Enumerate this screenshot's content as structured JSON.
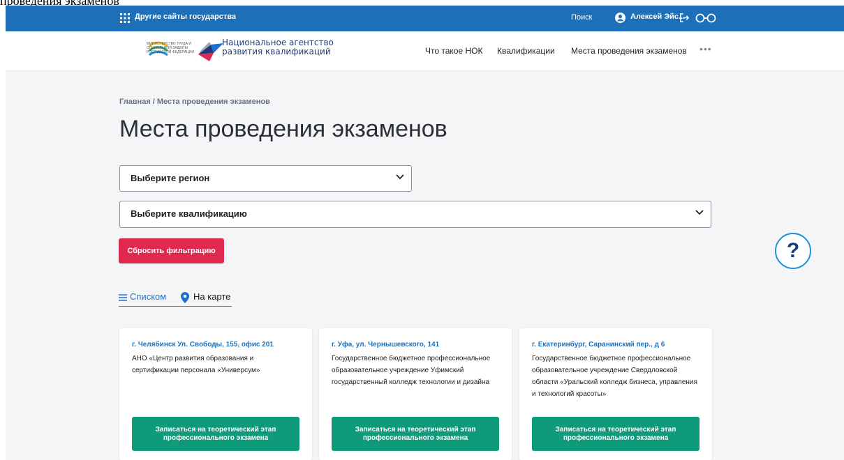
{
  "cut_text": "проведения экзаменов",
  "topbar": {
    "other_sites": "Другие сайты государства",
    "search": "Поиск",
    "user_name": "Алексей Эйс...",
    "bg_color": "#1d6fb8"
  },
  "header": {
    "ministry_text": "Министерство труда и социальной защиты Российской Федерации",
    "nark_name": "Национальное агентство развития квалификаций",
    "nav": [
      "Что такое НОК",
      "Квалификации",
      "Места проведения экзаменов"
    ],
    "more": "•••"
  },
  "main": {
    "breadcrumb": "Главная / Места проведения экзаменов",
    "title": "Места проведения экзаменов",
    "region_select": "Выберите регион",
    "qualification_select": "Выберите квалификацию",
    "reset_button": "Сбросить фильтрацию",
    "help": "?",
    "view_list": "Списком",
    "view_map": "На карте"
  },
  "cards": [
    {
      "address": "г. Челябинск Ул. Свободы, 155, офис 201",
      "organization": "АНО «Центр развития образования и сертификации персонала «Универсум»",
      "button": "Записаться на теоретический этап профессионального экзамена"
    },
    {
      "address": "г. Уфа, ул. Чернышевского, 141",
      "organization": "Государственное бюджетное профессиональное образовательное учреждение Уфимский государственный колледж технологии и дизайна",
      "button": "Записаться на теоретический этап профессионального экзамена"
    },
    {
      "address": "г. Екатеринбург, Саранинский пер., д 6",
      "organization": "Государственное бюджетное профессиональное образовательное учреждение Свердловской области «Уральский колледж бизнеса, управления и технологий красоты»",
      "button": "Записаться на теоретический этап профессионального экзамена"
    }
  ],
  "colors": {
    "accent": "#1d6fb8",
    "reset": "#e0294f",
    "signup": "#0f9a7b",
    "page_bg": "#f4f5f7"
  }
}
